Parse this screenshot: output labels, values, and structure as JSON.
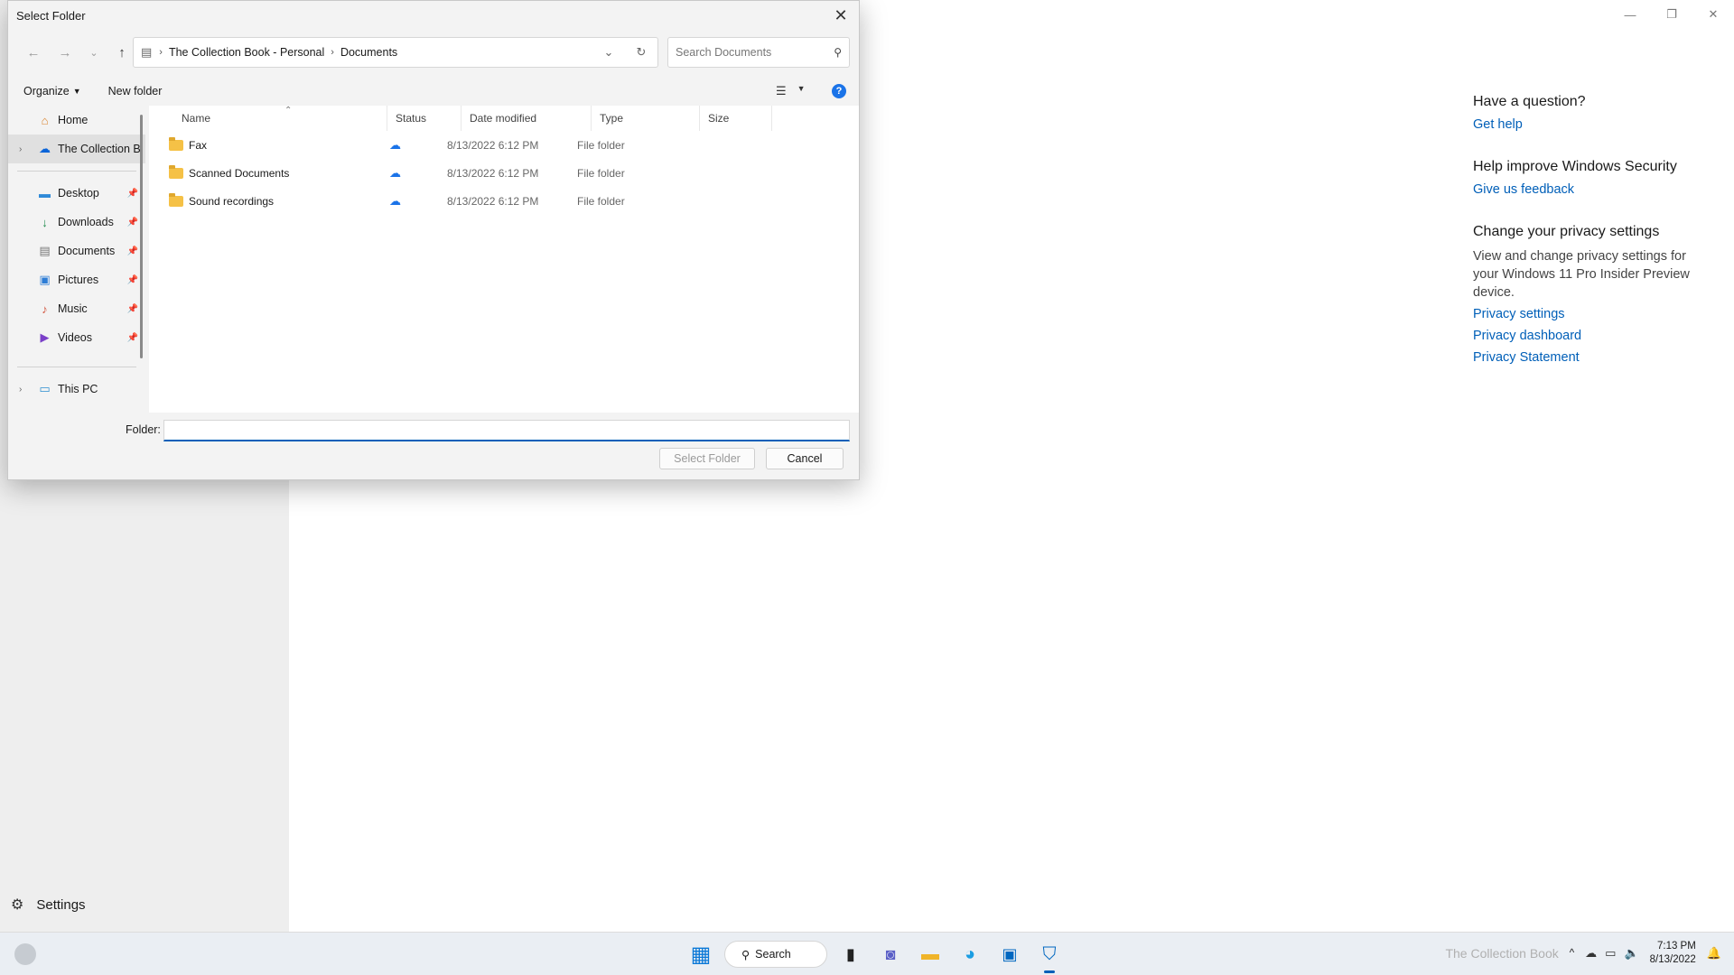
{
  "background": {
    "settings_label": "Settings",
    "help": {
      "question_title": "Have a question?",
      "get_help": "Get help",
      "improve_title": "Help improve Windows Security",
      "feedback": "Give us feedback",
      "privacy_title": "Change your privacy settings",
      "privacy_desc": "View and change privacy settings for your Windows 11 Pro Insider Preview device.",
      "privacy_settings": "Privacy settings",
      "privacy_dashboard": "Privacy dashboard",
      "privacy_statement": "Privacy Statement"
    },
    "window_controls": [
      "minimize-icon",
      "restore-icon",
      "close-icon"
    ]
  },
  "dialog": {
    "title": "Select Folder",
    "breadcrumb": [
      "The Collection Book - Personal",
      "Documents"
    ],
    "search_placeholder": "Search Documents",
    "organize": "Organize",
    "new_folder": "New folder",
    "nav": {
      "home": "Home",
      "onedrive": "The Collection B",
      "desktop": "Desktop",
      "downloads": "Downloads",
      "documents": "Documents",
      "pictures": "Pictures",
      "music": "Music",
      "videos": "Videos",
      "thispc": "This PC"
    },
    "columns": {
      "name": "Name",
      "status": "Status",
      "date": "Date modified",
      "type": "Type",
      "size": "Size"
    },
    "files": [
      {
        "name": "Fax",
        "date": "8/13/2022 6:12 PM",
        "type": "File folder"
      },
      {
        "name": "Scanned Documents",
        "date": "8/13/2022 6:12 PM",
        "type": "File folder"
      },
      {
        "name": "Sound recordings",
        "date": "8/13/2022 6:12 PM",
        "type": "File folder"
      }
    ],
    "folder_label": "Folder:",
    "folder_value": "",
    "select_button": "Select Folder",
    "cancel_button": "Cancel"
  },
  "taskbar": {
    "search_label": "Search",
    "time": "7:13 PM",
    "date": "8/13/2022",
    "watermark": "The Collection Book"
  },
  "colors": {
    "accent": "#005fb8",
    "folder": "#f5c146"
  }
}
